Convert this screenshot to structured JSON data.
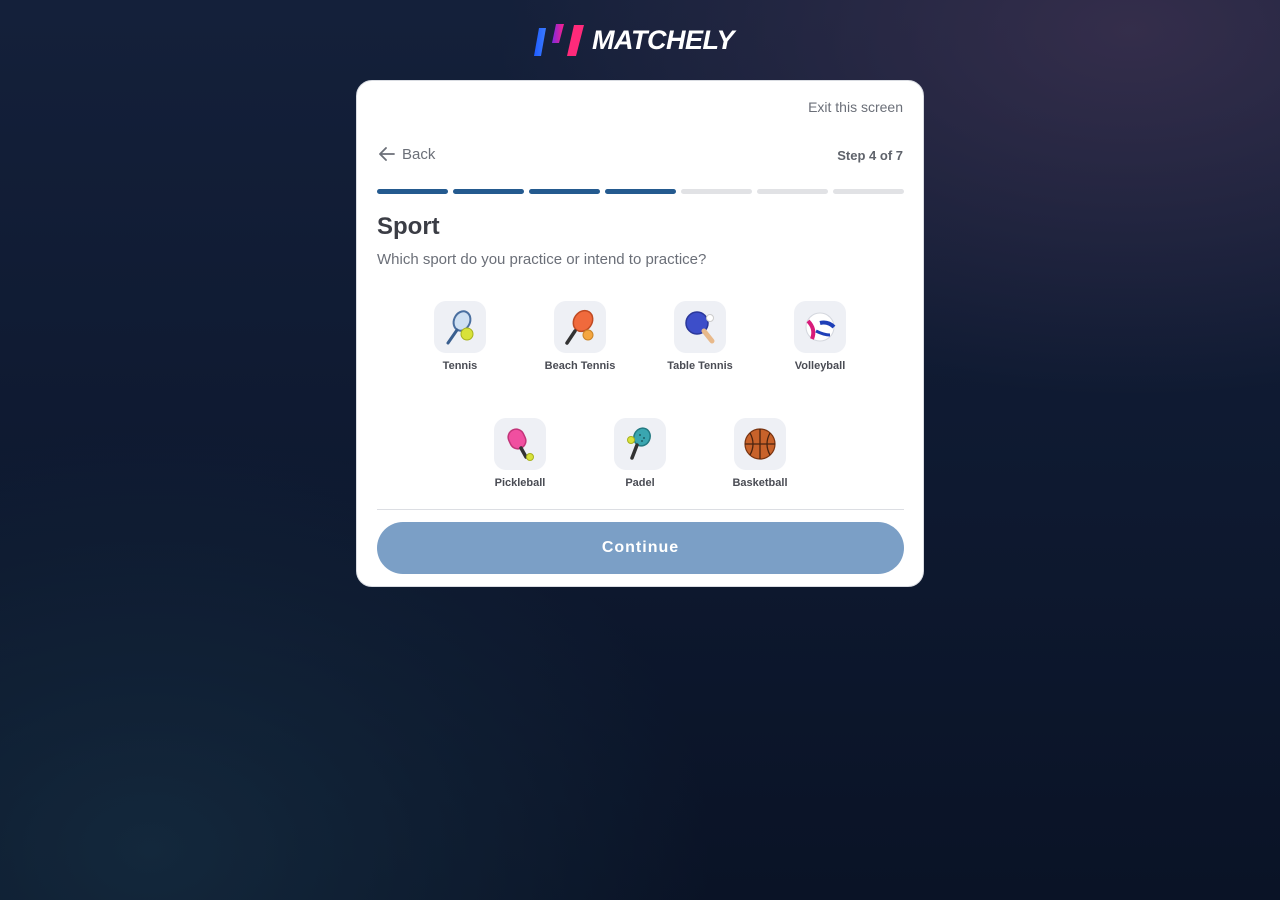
{
  "brand": {
    "name": "MATCHELY",
    "icon": "matchely-logo-mark"
  },
  "header": {
    "exit_label": "Exit this screen",
    "back_label": "Back",
    "step_label": "Step 4 of 7"
  },
  "progress": {
    "current_step": 4,
    "total_steps": 7,
    "fill_color": "#245a8f",
    "empty_color": "#e1e2e5"
  },
  "question": {
    "title": "Sport",
    "subtitle": "Which sport do you practice or intend to practice?"
  },
  "sports": [
    {
      "label": "Tennis",
      "icon": "tennis-racket-icon"
    },
    {
      "label": "Beach Tennis",
      "icon": "beach-tennis-paddle-icon"
    },
    {
      "label": "Table Tennis",
      "icon": "ping-pong-paddle-icon"
    },
    {
      "label": "Volleyball",
      "icon": "volleyball-icon"
    },
    {
      "label": "Pickleball",
      "icon": "pickleball-paddle-icon"
    },
    {
      "label": "Padel",
      "icon": "padel-racket-icon"
    },
    {
      "label": "Basketball",
      "icon": "basketball-icon"
    }
  ],
  "footer": {
    "continue_label": "Continue",
    "continue_color": "#7b9fc6"
  }
}
